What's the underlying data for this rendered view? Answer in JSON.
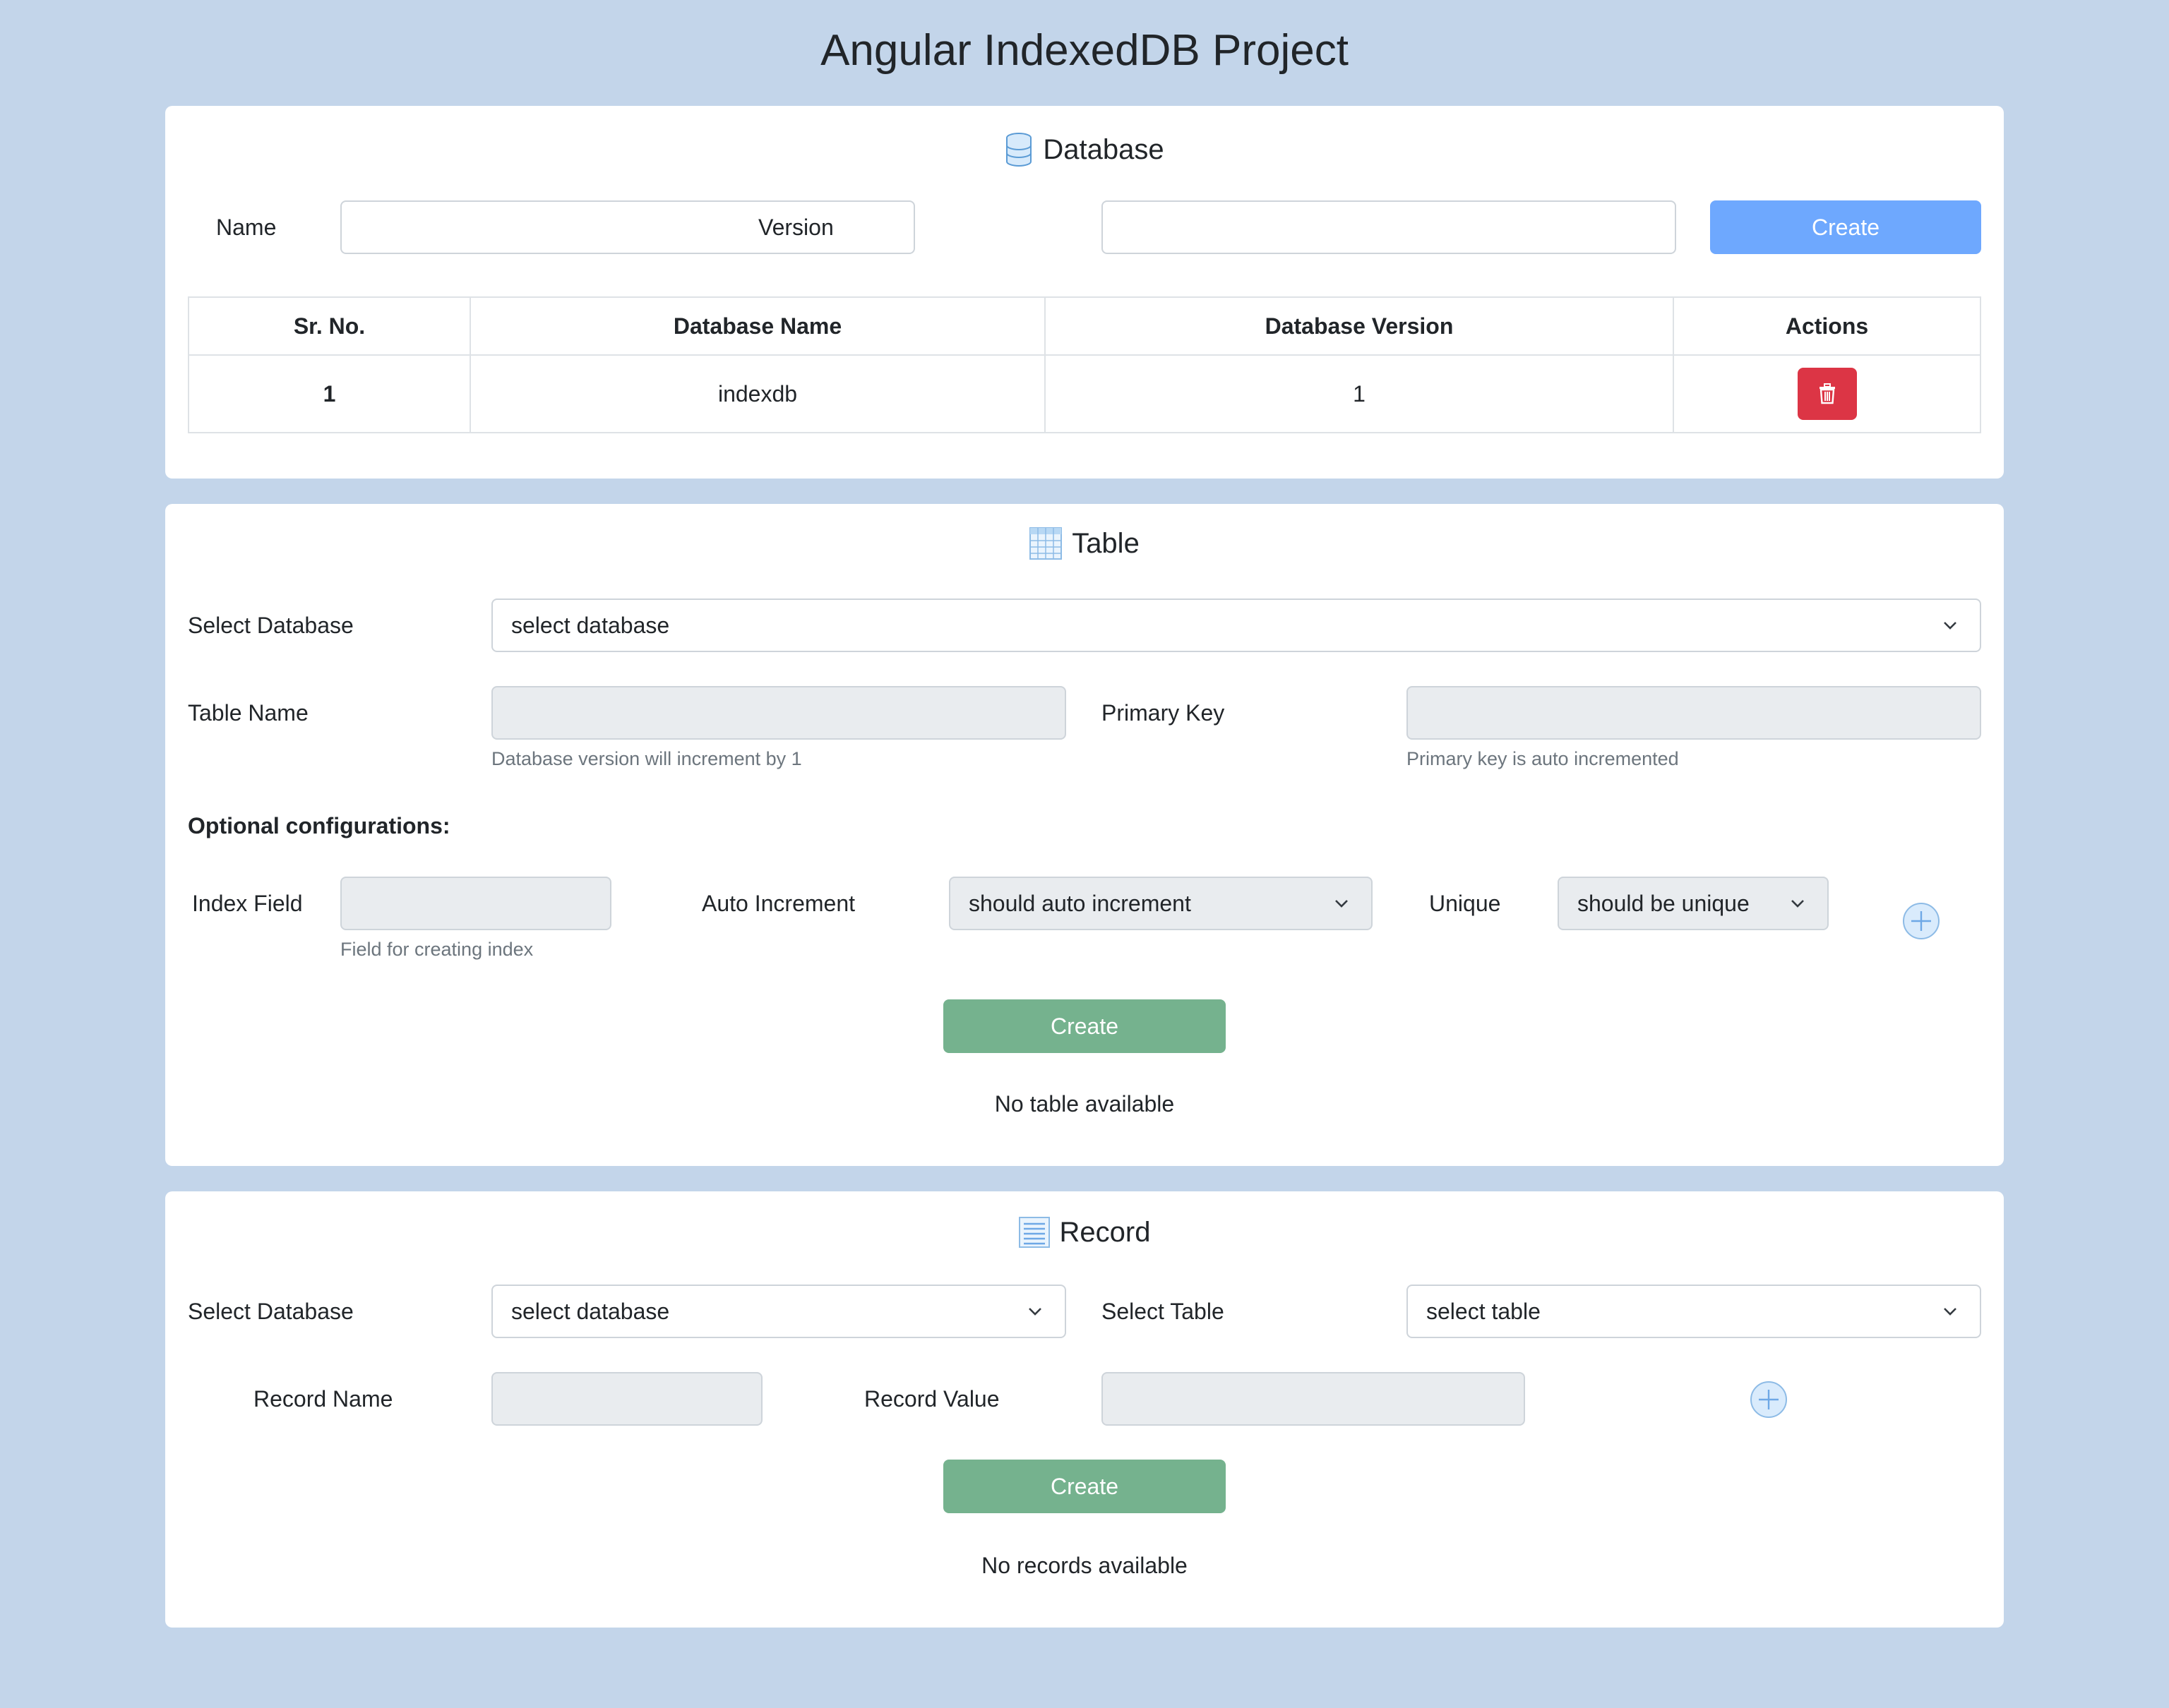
{
  "page": {
    "title": "Angular IndexedDB Project"
  },
  "database": {
    "title": "Database",
    "icon": "database-icon",
    "name_label": "Name",
    "name_value": "",
    "version_label": "Version",
    "version_value": "",
    "create_label": "Create",
    "table": {
      "headers": [
        "Sr. No.",
        "Database Name",
        "Database Version",
        "Actions"
      ],
      "rows": [
        {
          "sr": "1",
          "name": "indexdb",
          "version": "1",
          "action_icon": "trash-icon"
        }
      ]
    }
  },
  "table_section": {
    "title": "Table",
    "icon": "table-icon",
    "select_db_label": "Select Database",
    "select_db_value": "select database",
    "table_name_label": "Table Name",
    "table_name_help": "Database version will increment by 1",
    "primary_key_label": "Primary Key",
    "primary_key_help": "Primary key is auto incremented",
    "optional_label": "Optional configurations:",
    "index_field_label": "Index Field",
    "index_field_help": "Field for creating index",
    "auto_increment_label": "Auto Increment",
    "auto_increment_value": "should auto increment",
    "unique_label": "Unique",
    "unique_value": "should be unique",
    "create_label": "Create",
    "empty_message": "No table available"
  },
  "record_section": {
    "title": "Record",
    "icon": "list-icon",
    "select_db_label": "Select Database",
    "select_db_value": "select database",
    "select_table_label": "Select Table",
    "select_table_value": "select table",
    "record_name_label": "Record Name",
    "record_value_label": "Record Value",
    "create_label": "Create",
    "empty_message": "No records available"
  },
  "colors": {
    "background": "#c3d5ea",
    "primary_disabled": "#6ea8fe",
    "success_disabled": "#75b28e",
    "danger": "#dc3545"
  }
}
